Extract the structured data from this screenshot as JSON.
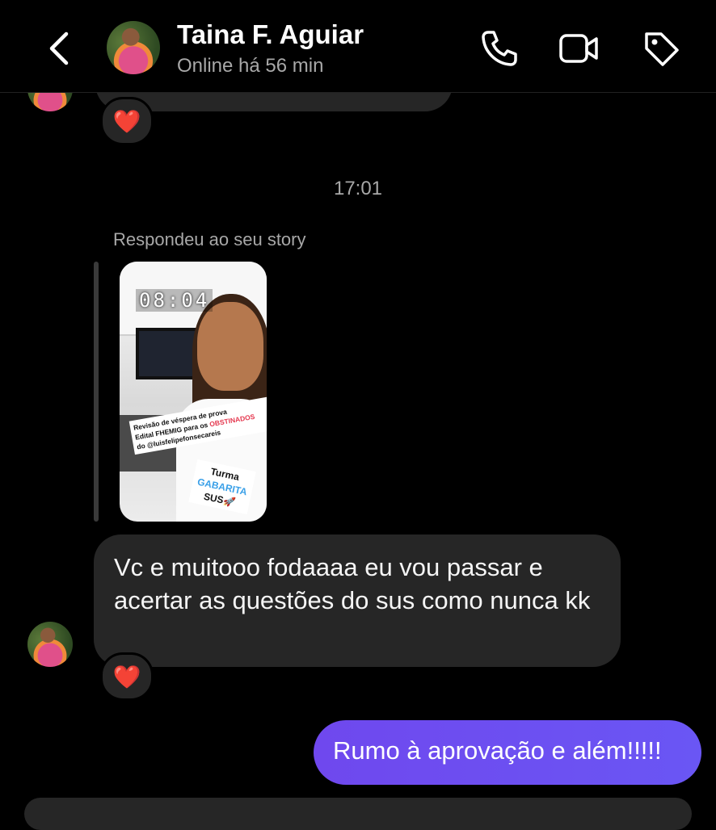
{
  "header": {
    "back_icon": "chevron-left-icon",
    "contact_name": "Taina F. Aguiar",
    "status": "Online há 56 min",
    "phone_icon": "phone-icon",
    "video_icon": "video-camera-icon",
    "tag_icon": "tag-icon"
  },
  "conversation": {
    "reaction_emoji": "❤️",
    "timestamp": "17:01",
    "reply_label": "Respondeu ao seu story",
    "story": {
      "timer": "08:04",
      "sticker_text_line1": "Revisão de véspera de prova",
      "sticker_text_line2a": "Edital FHEMIG para os ",
      "sticker_text_line2b": "OBSTINADOS",
      "sticker_text_line3": "do @luisfelipefonsecareis",
      "badge_line1": "Turma",
      "badge_line2": "GABARITA",
      "badge_line3": "SUS🚀"
    },
    "incoming_message": "Vc e muitooo fodaaaa eu vou passar e acertar as questões do sus como nunca kk",
    "incoming_reaction": "❤️",
    "outgoing_message": "Rumo à aprovação e além!!!!!"
  },
  "colors": {
    "background": "#000000",
    "incoming_bubble": "#262626",
    "outgoing_bubble": "#6a4ef0",
    "secondary_text": "#a8a8a8"
  }
}
